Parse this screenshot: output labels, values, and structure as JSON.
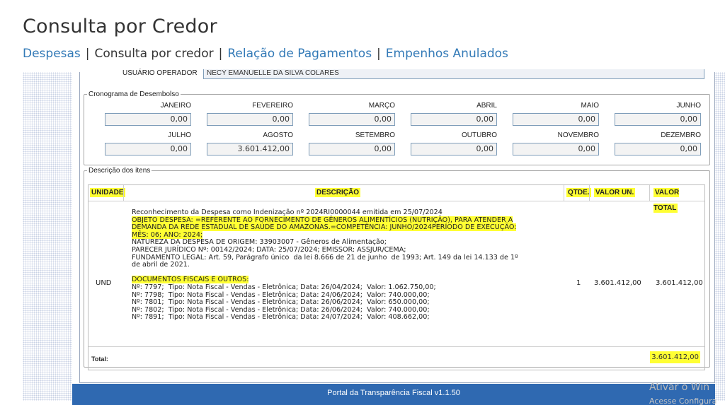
{
  "page": {
    "title": "Consulta por Credor",
    "nav": {
      "despesas": "Despesas",
      "sep": "|",
      "consulta": "Consulta por credor",
      "relacao": "Relação de Pagamentos",
      "empenhos": "Empenhos Anulados"
    }
  },
  "operator": {
    "label": "USUÁRIO OPERADOR",
    "value": "NECY EMANUELLE DA SILVA COLARES"
  },
  "cronograma": {
    "legend": "Cronograma de Desembolso",
    "months": [
      {
        "label": "JANEIRO",
        "value": "0,00"
      },
      {
        "label": "FEVEREIRO",
        "value": "0,00"
      },
      {
        "label": "MARÇO",
        "value": "0,00"
      },
      {
        "label": "ABRIL",
        "value": "0,00"
      },
      {
        "label": "MAIO",
        "value": "0,00"
      },
      {
        "label": "JUNHO",
        "value": "0,00"
      },
      {
        "label": "JULHO",
        "value": "0,00"
      },
      {
        "label": "AGOSTO",
        "value": "3.601.412,00"
      },
      {
        "label": "SETEMBRO",
        "value": "0,00"
      },
      {
        "label": "OUTUBRO",
        "value": "0,00"
      },
      {
        "label": "NOVEMBRO",
        "value": "0,00"
      },
      {
        "label": "DEZEMBRO",
        "value": "0,00"
      }
    ]
  },
  "itens": {
    "legend": "Descrição dos itens",
    "headers": {
      "unidade": "UNIDADE",
      "descricao": "DESCRIÇÃO",
      "qtde": "QTDE.",
      "valor_un": "VALOR UN.",
      "valor_total": "VALOR TOTAL"
    },
    "row": {
      "unidade": "UND",
      "qtde": "1",
      "valor_un": "3.601.412,00",
      "valor_total": "3.601.412,00",
      "description_lines": [
        "Reconhecimento da Despesa como Indenização nº 2024RI0000044 emitida em 25/07/2024",
        "OBJETO DESPESA: =REFERENTE AO FORNECIMENTO DE GÊNEROS ALIMENTÍCIOS (NUTRIÇÃO), PARA ATENDER A",
        "DEMANDA DA REDE ESTADUAL DE SAÚDE DO AMAZONAS.=COMPETÊNCIA: JUNHO/2024PERÍODO DE EXECUÇÃO:",
        "MÊS: 06; ANO: 2024;",
        "NATUREZA DA DESPESA DE ORIGEM: 33903007 - Gêneros de Alimentação;",
        "PARECER JURÍDICO Nº: 00142/2024; DATA: 25/07/2024; EMISSOR: ASSJUR/CEMA;",
        "FUNDAMENTO LEGAL: Art. 59, Parágrafo único  da lei 8.666 de 21 de junho  de 1993; Art. 149 da lei 14.133 de 1º",
        "de abril de 2021.",
        "",
        "DOCUMENTOS FISCAIS E OUTROS:",
        "Nº: 7797;  Tipo: Nota Fiscal - Vendas - Eletrônica; Data: 26/04/2024;  Valor: 1.062.750,00;",
        "Nº: 7798;  Tipo: Nota Fiscal - Vendas - Eletrônica; Data: 24/06/2024;  Valor: 740.000,00;",
        "Nº: 7801;  Tipo: Nota Fiscal - Vendas - Eletrônica; Data: 26/06/2024;  Valor: 650.000,00;",
        "Nº: 7802;  Tipo: Nota Fiscal - Vendas - Eletrônica; Data: 26/06/2024;  Valor: 740.000,00;",
        "Nº: 7891;  Tipo: Nota Fiscal - Vendas - Eletrônica; Data: 24/07/2024;  Valor: 408.662,00;"
      ]
    },
    "total_label": "Total:",
    "total_value": "3.601.412,00"
  },
  "footer": {
    "text": "Portal da Transparência Fiscal v1.1.50"
  },
  "watermark": {
    "line1": "Ativar o Win",
    "line2": "Acesse Configura"
  },
  "colors": {
    "link": "#337ab7",
    "footer_bg": "#2f69b1",
    "highlight": "#ffff33"
  }
}
